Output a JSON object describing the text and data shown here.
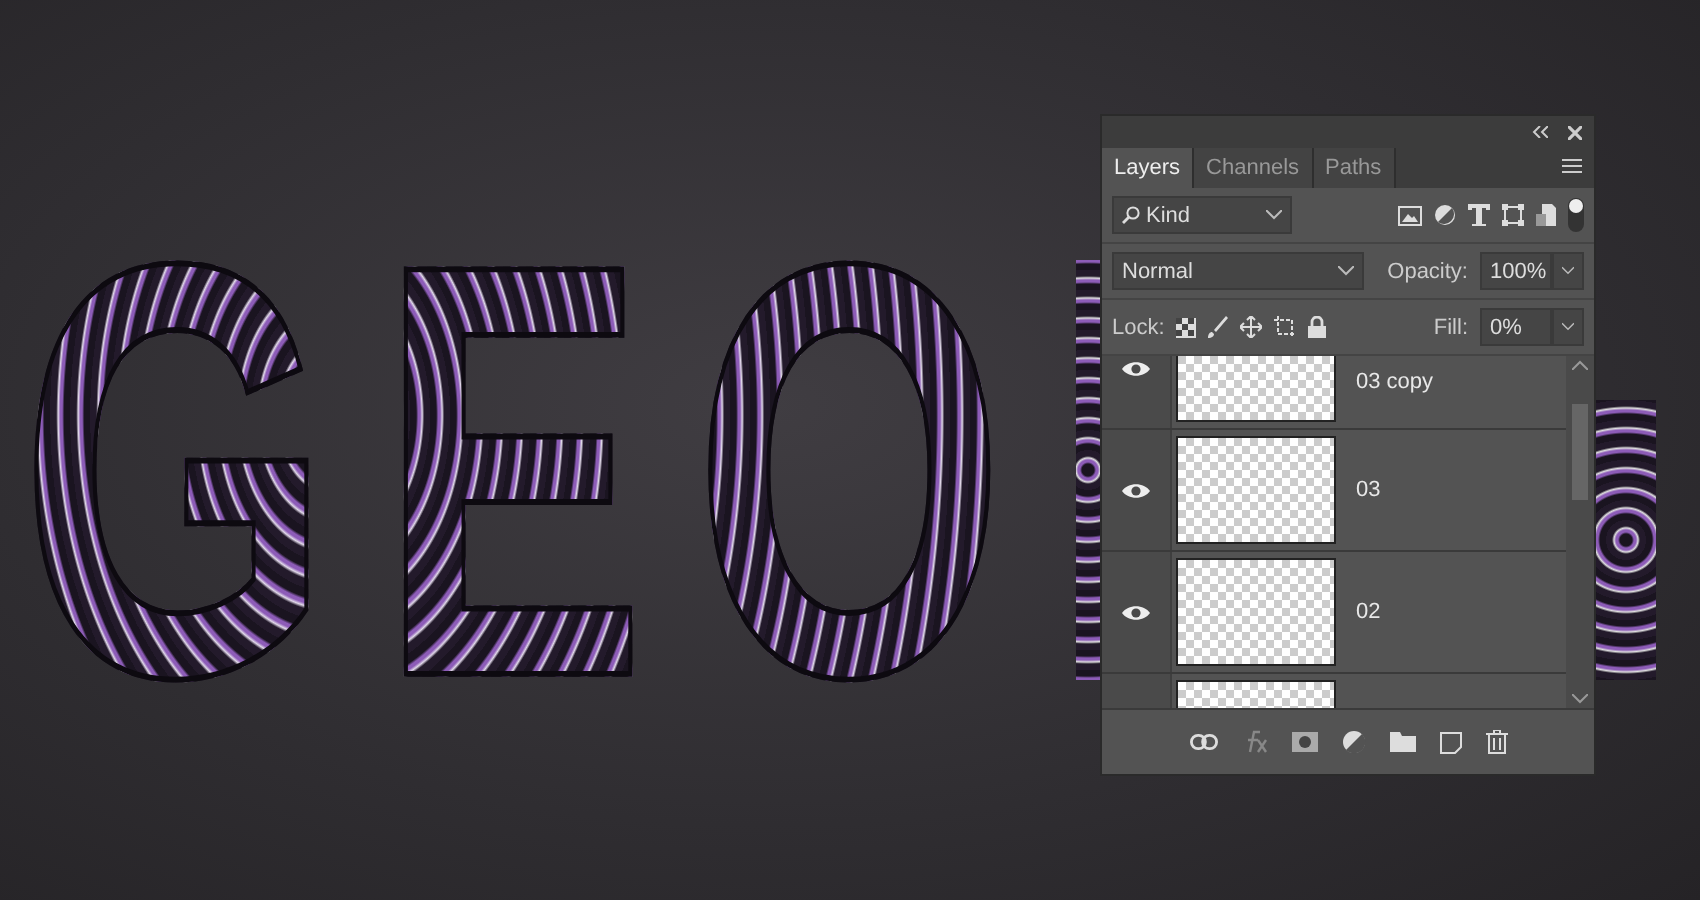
{
  "canvas": {
    "text": "GEO"
  },
  "panel": {
    "tabs": [
      {
        "label": "Layers",
        "selected": true
      },
      {
        "label": "Channels",
        "selected": false
      },
      {
        "label": "Paths",
        "selected": false
      }
    ],
    "filter": {
      "value": "Kind"
    },
    "blend_mode": {
      "value": "Normal"
    },
    "opacity": {
      "label": "Opacity:",
      "value": "100%"
    },
    "lock": {
      "label": "Lock:"
    },
    "fill": {
      "label": "Fill:",
      "value": "0%"
    },
    "layers": [
      {
        "name": "03 copy",
        "visible": true
      },
      {
        "name": "03",
        "visible": true
      },
      {
        "name": "02",
        "visible": true
      }
    ]
  }
}
